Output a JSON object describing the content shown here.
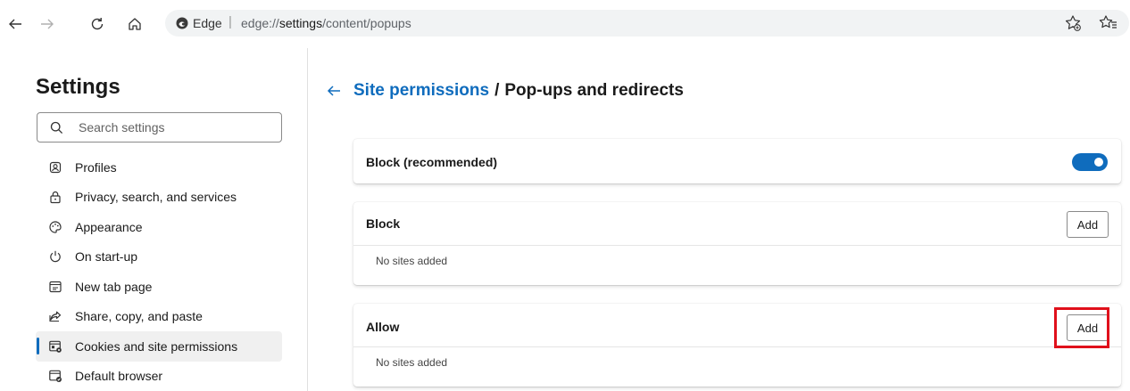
{
  "browser": {
    "address_site": "Edge",
    "address_separator": "|",
    "address_url_prefix": "edge://",
    "address_url_bold": "settings",
    "address_url_suffix": "/content/popups"
  },
  "sidebar": {
    "title": "Settings",
    "search_placeholder": "Search settings",
    "items": [
      {
        "label": "Profiles",
        "icon": "profile-icon"
      },
      {
        "label": "Privacy, search, and services",
        "icon": "lock-icon"
      },
      {
        "label": "Appearance",
        "icon": "palette-icon"
      },
      {
        "label": "On start-up",
        "icon": "power-icon"
      },
      {
        "label": "New tab page",
        "icon": "new-tab-icon"
      },
      {
        "label": "Share, copy, and paste",
        "icon": "share-icon"
      },
      {
        "label": "Cookies and site permissions",
        "icon": "cookies-permissions-icon",
        "active": true
      },
      {
        "label": "Default browser",
        "icon": "default-browser-icon"
      }
    ]
  },
  "main": {
    "breadcrumb_link": "Site permissions",
    "breadcrumb_separator": "/",
    "breadcrumb_current": "Pop-ups and redirects",
    "block_recommended": {
      "label": "Block (recommended)",
      "enabled": true
    },
    "block": {
      "title": "Block",
      "add_label": "Add",
      "empty_text": "No sites added"
    },
    "allow": {
      "title": "Allow",
      "add_label": "Add",
      "empty_text": "No sites added",
      "highlighted": true
    }
  },
  "colors": {
    "accent": "#0f6cbd",
    "highlight": "#e0101b"
  }
}
